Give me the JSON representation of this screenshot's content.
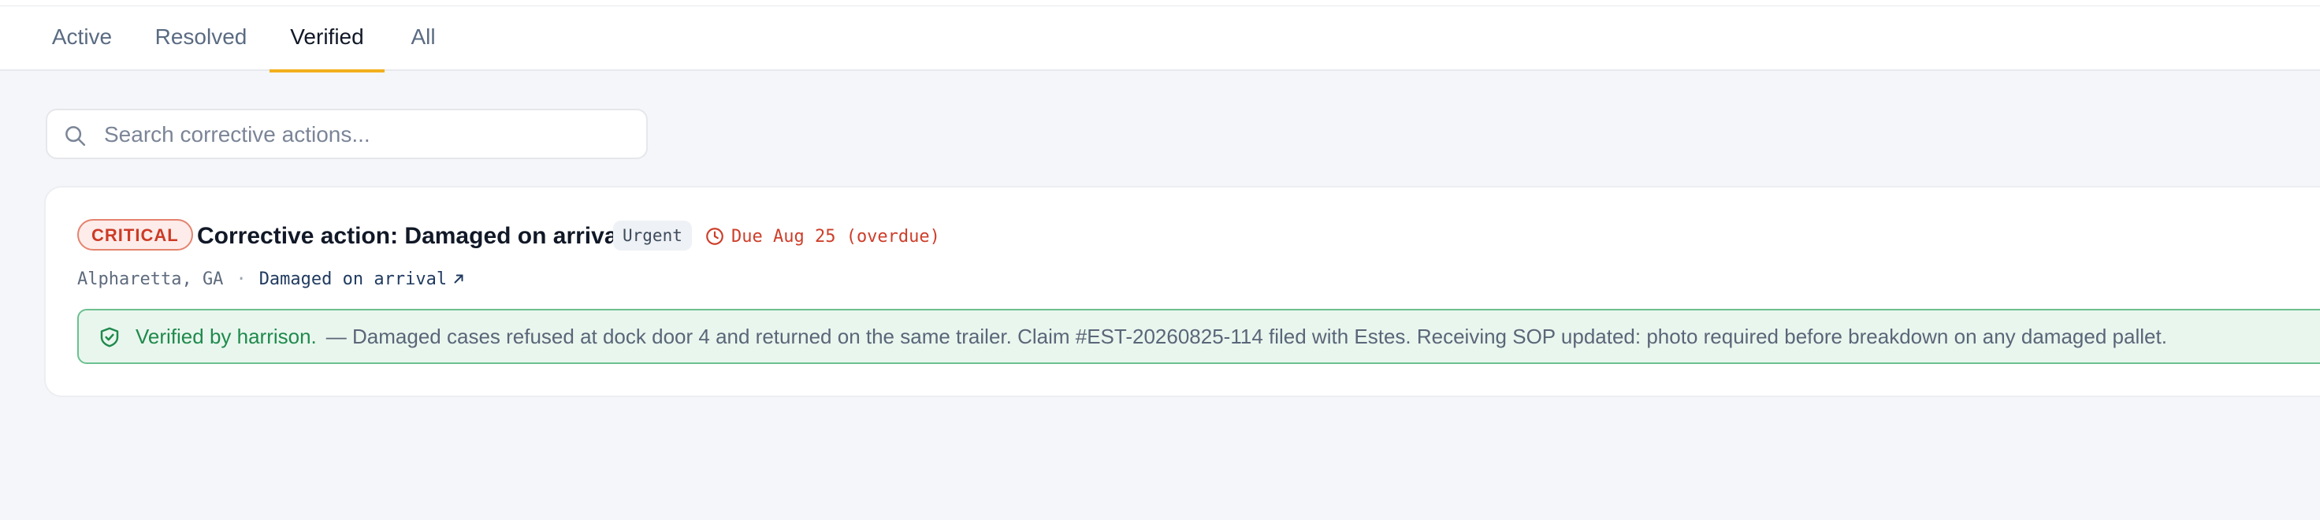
{
  "tabs": [
    {
      "label": "Active"
    },
    {
      "label": "Resolved"
    },
    {
      "label": "Verified"
    },
    {
      "label": "All"
    }
  ],
  "active_tab": "Verified",
  "search": {
    "placeholder": "Search corrective actions...",
    "value": "",
    "icon": "search-icon"
  },
  "card": {
    "severity": "CRITICAL",
    "title": "Corrective action: Damaged on arrival",
    "priority": "Urgent",
    "due": "Due Aug 25 (overdue)",
    "location": "Alpharetta, GA",
    "separator": "·",
    "issue_link": "Damaged on arrival",
    "verified_by": "Verified by harrison.",
    "verification_note": "— Damaged cases refused at dock door 4 and returned on the same trailer. Claim #EST-20260825-114 filed with Estes. Receiving SOP updated: photo required before breakdown on any damaged pallet."
  },
  "colors": {
    "accent": "#f2b01e",
    "critical": "#cc3b26",
    "verified": "#1f8a4c",
    "background": "#f5f6f9"
  },
  "icons": [
    "search-icon",
    "clock-icon",
    "external-link-icon",
    "shield-check-icon"
  ]
}
